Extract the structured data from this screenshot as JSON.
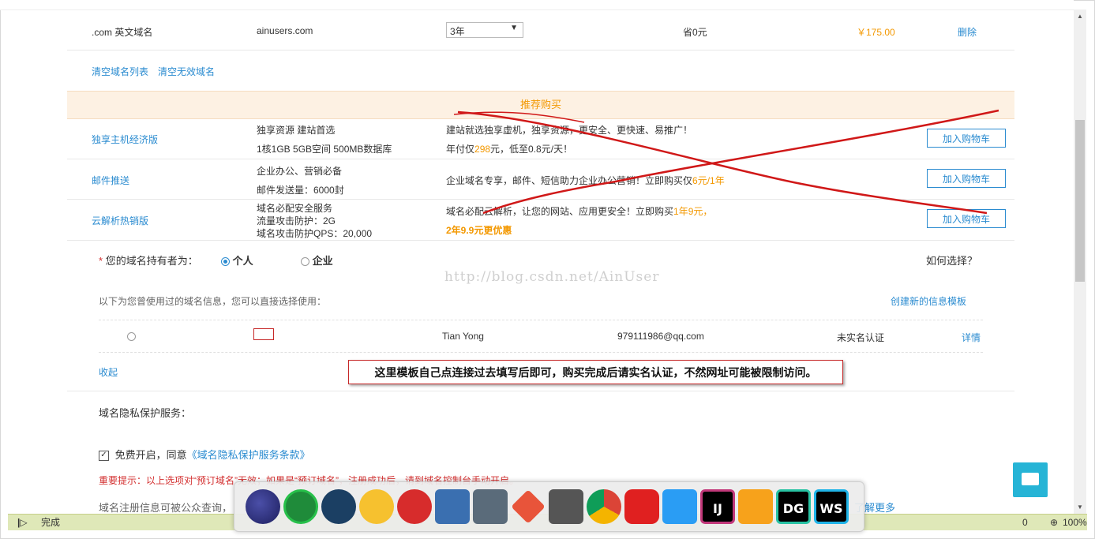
{
  "domain_row": {
    "type": ".com 英文域名",
    "name": "ainusers.com",
    "period": "3年",
    "saving": "省0元",
    "price": "￥175.00",
    "delete": "删除"
  },
  "list_actions": {
    "clear_list": "清空域名列表",
    "clear_invalid": "清空无效域名"
  },
  "recommend": {
    "title": "推荐购买",
    "items": [
      {
        "name": "独享主机经济版",
        "spec1": "独享资源 建站首选",
        "spec2": "1核1GB 5GB空间 500MB数据库",
        "desc1": "建站就选独享虚机，独享资源，更安全、更快速、易推广！",
        "desc2a": "年付仅",
        "desc2b": "298",
        "desc2c": "元，低至0.8元/天！",
        "button": "加入购物车"
      },
      {
        "name": "邮件推送",
        "spec1": "企业办公、营销必备",
        "spec2": "邮件发送量：6000封",
        "desc1a": "企业域名专享，邮件、短信助力企业办公营销！立即购买仅",
        "desc1b": "6元/1年",
        "button": "加入购物车"
      },
      {
        "name": "云解析热销版",
        "spec1": "域名必配安全服务",
        "spec2": "流量攻击防护：2G",
        "spec3": "域名攻击防护QPS：20,000",
        "desc1a": "域名必配云解析，让您的网站、应用更安全！立即购买",
        "desc1b": "1年9元，",
        "desc2": "2年9.9元更优惠",
        "button": "加入购物车"
      }
    ]
  },
  "holder": {
    "required_mark": "*",
    "label": "您的域名持有者为：",
    "option_personal": "个人",
    "option_company": "企业",
    "help": "如何选择？",
    "used_info": "以下为您曾使用过的域名信息，您可以直接选择使用：",
    "create_template": "创建新的信息模板",
    "record": {
      "name": "Tian Yong",
      "email": "979111986@qq.com",
      "status": "未实名认证",
      "detail": "详情"
    },
    "collapse": "收起"
  },
  "callout": "这里模板自己点连接过去填写后即可，购买完成后请实名认证，不然网址可能被限制访问。",
  "watermark": "http://blog.csdn.net/AinUser",
  "privacy": {
    "title": "域名隐私保护服务：",
    "free_label": "免费开启，同意",
    "terms_link": "《域名隐私保护服务条款》",
    "warning": "重要提示：以上选项对“预订域名”无效；如果是“预订域名”，注册成功后，请到域名控制台手动开启。",
    "info_prefix": "域名注册信息可被公众查询，",
    "learn_more": "了解更多"
  },
  "statusbar": {
    "text": "完成",
    "zoom": "100%",
    "count": "0"
  },
  "taskbar": {
    "apps": [
      "eclipse-icon",
      "upwork-icon",
      "steam-icon",
      "yellow-app-icon",
      "red-app-icon",
      "virtualbox-icon",
      "terminal-icon",
      "git-icon",
      "lock-app-icon",
      "chrome-icon",
      "netease-music-icon",
      "dingtalk-icon",
      "intellij-icon",
      "hotel-app-icon",
      "datagrip-icon",
      "webstorm-icon"
    ],
    "labels": {
      "intellij": "IJ",
      "datagrip": "DG",
      "webstorm": "WS"
    }
  }
}
